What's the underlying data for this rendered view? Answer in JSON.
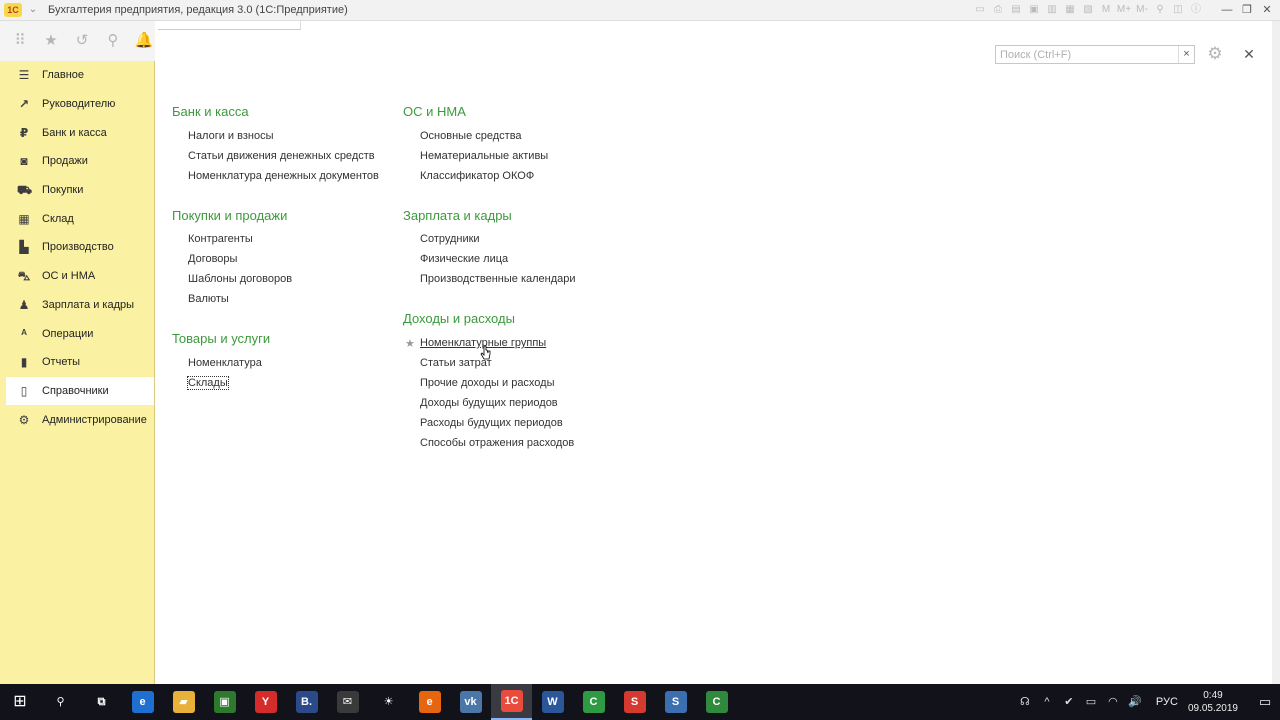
{
  "window": {
    "app_logo": "1С",
    "title": "Бухгалтерия предприятия, редакция 3.0 (1С:Предприятие)",
    "tool_icons": [
      "calc-icon",
      "print-icon",
      "preview-icon",
      "save-icon",
      "doc-icon",
      "table-icon",
      "grid-icon",
      "m-icon",
      "m-plus-icon",
      "m-minus-icon",
      "search-icon",
      "panel-icon",
      "info-icon"
    ],
    "tool_glyphs": [
      "▭",
      "⎙",
      "▤",
      "▣",
      "▥",
      "▦",
      "▧",
      "M",
      "M+",
      "M-",
      "⚲",
      "◫",
      "ⓘ"
    ],
    "controls": {
      "minimize": "—",
      "restore": "❐",
      "close": "✕"
    }
  },
  "topstrip": {
    "icons": [
      {
        "name": "apps-grid-icon",
        "glyph": "⠿"
      },
      {
        "name": "favorites-star-icon",
        "glyph": "★"
      },
      {
        "name": "history-icon",
        "glyph": "↺"
      },
      {
        "name": "search-icon",
        "glyph": "⚲"
      },
      {
        "name": "notifications-bell-icon",
        "glyph": "🔔"
      }
    ]
  },
  "sidebar": {
    "items": [
      {
        "label": "Главное",
        "icon": "menu-lines-icon",
        "glyph": "☰"
      },
      {
        "label": "Руководителю",
        "icon": "trend-chart-icon",
        "glyph": "↗"
      },
      {
        "label": "Банк и касса",
        "icon": "coin-icon",
        "glyph": "₽"
      },
      {
        "label": "Продажи",
        "icon": "shopping-bag-icon",
        "glyph": "◙"
      },
      {
        "label": "Покупки",
        "icon": "cart-icon",
        "glyph": "⛟"
      },
      {
        "label": "Склад",
        "icon": "warehouse-icon",
        "glyph": "▦"
      },
      {
        "label": "Производство",
        "icon": "factory-icon",
        "glyph": "▙"
      },
      {
        "label": "ОС и НМА",
        "icon": "car-icon",
        "glyph": "⛍"
      },
      {
        "label": "Зарплата и кадры",
        "icon": "person-icon",
        "glyph": "♟"
      },
      {
        "label": "Операции",
        "icon": "operations-icon",
        "glyph": "ᴬ"
      },
      {
        "label": "Отчеты",
        "icon": "bar-chart-icon",
        "glyph": "▮"
      },
      {
        "label": "Справочники",
        "icon": "book-icon",
        "glyph": "▯"
      },
      {
        "label": "Администрирование",
        "icon": "settings-gear-icon",
        "glyph": "⚙"
      }
    ],
    "active_index": 11
  },
  "search": {
    "placeholder": "Поиск (Ctrl+F)",
    "clear": "×"
  },
  "main_icons": {
    "gear": "⚙",
    "close": "✕"
  },
  "sections": {
    "bank": {
      "title": "Банк и касса",
      "links": [
        "Налоги и взносы",
        "Статьи движения денежных средств",
        "Номенклатура денежных документов"
      ]
    },
    "purchases_sales": {
      "title": "Покупки и продажи",
      "links": [
        "Контрагенты",
        "Договоры",
        "Шаблоны договоров",
        "Валюты"
      ]
    },
    "goods": {
      "title": "Товары и услуги",
      "links": [
        "Номенклатура",
        "Склады"
      ]
    },
    "os_nma": {
      "title": "ОС и НМА",
      "links": [
        "Основные средства",
        "Нематериальные активы",
        "Классификатор ОКОФ"
      ]
    },
    "salary": {
      "title": "Зарплата и кадры",
      "links": [
        "Сотрудники",
        "Физические лица",
        "Производственные календари"
      ]
    },
    "income_expense": {
      "title": "Доходы и расходы",
      "links": [
        "Номенклатурные группы",
        "Статьи затрат",
        "Прочие доходы и расходы",
        "Доходы будущих периодов",
        "Расходы будущих периодов",
        "Способы отражения расходов"
      ]
    }
  },
  "taskbar": {
    "start_glyph": "⊞",
    "apps": [
      {
        "name": "search-taskbar-icon",
        "glyph": "⚲",
        "color": "#12121a"
      },
      {
        "name": "task-view-icon",
        "glyph": "⧉",
        "color": "#12121a"
      },
      {
        "name": "edge-browser-icon",
        "glyph": "e",
        "color": "#1e6fd0"
      },
      {
        "name": "file-explorer-icon",
        "glyph": "▰",
        "color": "#e8b13a"
      },
      {
        "name": "store-icon",
        "glyph": "▣",
        "color": "#2d7a2d"
      },
      {
        "name": "yandex-browser-icon",
        "glyph": "Y",
        "color": "#d42b2b"
      },
      {
        "name": "bitrix-icon",
        "glyph": "B.",
        "color": "#2a4a8a"
      },
      {
        "name": "mail-icon",
        "glyph": "✉",
        "color": "#3a3a3a"
      },
      {
        "name": "brightness-icon",
        "glyph": "☀",
        "color": "#12121a"
      },
      {
        "name": "firefox-icon",
        "glyph": "e",
        "color": "#e8650f"
      },
      {
        "name": "vk-icon",
        "glyph": "vk",
        "color": "#4a76a8"
      },
      {
        "name": "1c-app-icon",
        "glyph": "1С",
        "color": "#e94b3c"
      },
      {
        "name": "word-icon",
        "glyph": "W",
        "color": "#2b579a"
      },
      {
        "name": "camtasia-green-icon",
        "glyph": "C",
        "color": "#2e9a44"
      },
      {
        "name": "app-s-red-icon",
        "glyph": "S",
        "color": "#d43a2f"
      },
      {
        "name": "app-s-blue-icon",
        "glyph": "S",
        "color": "#3b6fb0"
      },
      {
        "name": "camtasia-icon",
        "glyph": "C",
        "color": "#2f8a3d"
      }
    ],
    "active_app": "1c-app-icon",
    "tray": {
      "icons": [
        {
          "name": "people-icon",
          "glyph": "☊"
        },
        {
          "name": "tray-up-arrow-icon",
          "glyph": "^"
        },
        {
          "name": "shield-check-icon",
          "glyph": "✔"
        },
        {
          "name": "battery-icon",
          "glyph": "▭"
        },
        {
          "name": "wifi-icon",
          "glyph": "◠"
        },
        {
          "name": "volume-icon",
          "glyph": "🔊"
        }
      ],
      "lang": "РУС",
      "time": "0:49",
      "date": "09.05.2019",
      "notification_glyph": "▭"
    }
  },
  "colors": {
    "sidebar_bg": "#fbf1a3",
    "section_green": "#3c9a3c",
    "taskbar_bg": "#12121a"
  }
}
